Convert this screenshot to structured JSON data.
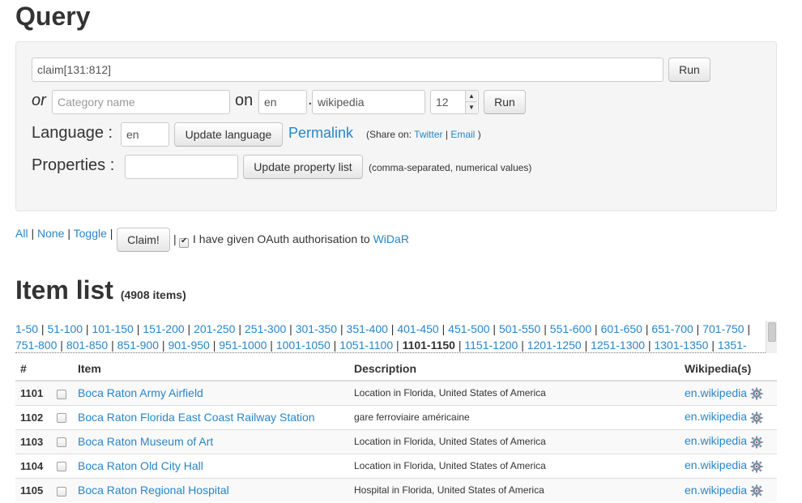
{
  "query": {
    "title": "Query",
    "claim_input": "claim[131:812]",
    "run_label": "Run",
    "or_label": "or",
    "category_placeholder": "Category name",
    "on_label": "on",
    "lang_value": "en",
    "dot": ".",
    "project_value": "wikipedia",
    "depth_value": "12",
    "run2_label": "Run",
    "language_label": "Language :",
    "language_value": "en",
    "update_language_label": "Update language",
    "permalink_label": "Permalink",
    "share_prefix": "(Share on:",
    "twitter_label": "Twitter",
    "share_sep": "|",
    "email_label": "Email",
    "share_suffix": ")",
    "properties_label": "Properties :",
    "properties_value": "",
    "update_property_label": "Update property list",
    "properties_hint": "(comma-separated, numerical values)"
  },
  "actions": {
    "all": "All",
    "none": "None",
    "toggle": "Toggle",
    "sep": "|",
    "claim_label": "Claim!",
    "oauth_prefix": "I have given OAuth authorisation to",
    "widar_label": "WiDaR",
    "oauth_checked": true
  },
  "item_list": {
    "title": "Item list",
    "count": "(4908 items)"
  },
  "pager": {
    "pages": [
      "1-50",
      "51-100",
      "101-150",
      "151-200",
      "201-250",
      "251-300",
      "301-350",
      "351-400",
      "401-450",
      "451-500",
      "501-550",
      "551-600",
      "601-650",
      "651-700",
      "701-750",
      "751-800",
      "801-850",
      "851-900",
      "901-950",
      "951-1000",
      "1001-1050",
      "1051-1100",
      "1101-1150",
      "1151-1200",
      "1201-1250",
      "1251-1300",
      "1301-1350",
      "1351-"
    ],
    "current": "1101-1150"
  },
  "table": {
    "headers": [
      "#",
      "Item",
      "Description",
      "Wikipedia(s)"
    ],
    "rows": [
      {
        "num": "1101",
        "item": "Boca Raton Army Airfield",
        "desc": "Location in Florida, United States of America",
        "wiki": "en.wikipedia"
      },
      {
        "num": "1102",
        "item": "Boca Raton Florida East Coast Railway Station",
        "desc": "gare ferroviaire américaine",
        "wiki": "en.wikipedia"
      },
      {
        "num": "1103",
        "item": "Boca Raton Museum of Art",
        "desc": "Location in Florida, United States of America",
        "wiki": "en.wikipedia"
      },
      {
        "num": "1104",
        "item": "Boca Raton Old City Hall",
        "desc": "Location in Florida, United States of America",
        "wiki": "en.wikipedia"
      },
      {
        "num": "1105",
        "item": "Boca Raton Regional Hospital",
        "desc": "Hospital in Florida, United States of America",
        "wiki": "en.wikipedia"
      }
    ]
  },
  "colors": {
    "link": "#2a85c6",
    "panel_bg": "#f5f5f5",
    "text": "#333333"
  },
  "icons": {
    "wiki_row": "gear-icon",
    "spinner_up": "triangle-up",
    "spinner_down": "triangle-down"
  }
}
